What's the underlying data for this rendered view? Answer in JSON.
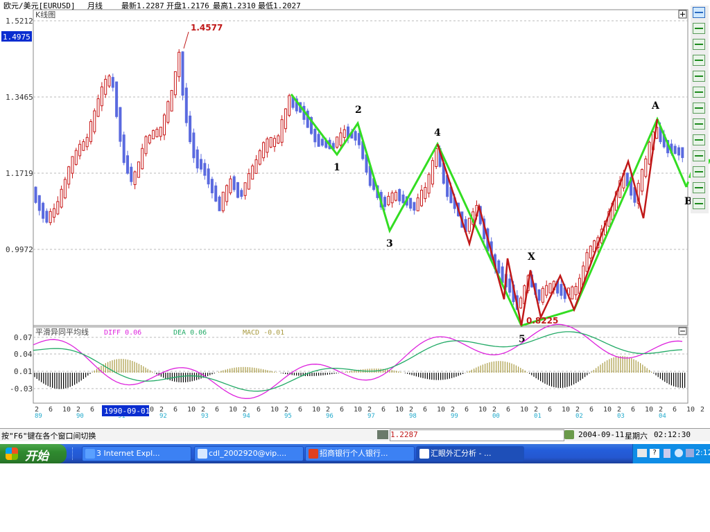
{
  "header": {
    "instrument": "欧元/美元[EURUSD]",
    "period": "月线",
    "latest": "最新1.2287",
    "open": "开盘1.2176",
    "high": "最高1.2310",
    "low": "最低1.2027"
  },
  "kline": {
    "panel_title": "K线图",
    "price_ticks": [
      "1.5212",
      "1.3465",
      "1.1719",
      "0.9972"
    ],
    "cursor_price": "1.4975",
    "high_label": "1.4577",
    "low_label": "0.8225",
    "wave_labels": [
      "1",
      "2",
      "3",
      "4",
      "5",
      "X",
      "A",
      "B",
      "C"
    ]
  },
  "macd": {
    "panel_title": "平滑异同平均线",
    "diff": "DIFF 0.06",
    "dea": "DEA 0.06",
    "macd": "MACD -0.01",
    "ticks": [
      "0.07",
      "0.04",
      "0.01",
      "-0.03"
    ]
  },
  "x_axis": {
    "months": [
      "2",
      "6",
      "10",
      "2",
      "6",
      "10",
      "2",
      "6",
      "10",
      "2",
      "6",
      "10",
      "2",
      "6",
      "10",
      "2",
      "6",
      "10",
      "2",
      "6",
      "10",
      "2",
      "6",
      "10",
      "2",
      "6",
      "10",
      "2",
      "6",
      "10",
      "2",
      "6",
      "10",
      "2",
      "6",
      "10",
      "2",
      "6",
      "10",
      "2",
      "6",
      "10",
      "2",
      "6",
      "10",
      "2",
      "6",
      "10",
      "2"
    ],
    "years": [
      "89",
      "90",
      "91",
      "92",
      "93",
      "94",
      "95",
      "96",
      "97",
      "98",
      "99",
      "00",
      "01",
      "02",
      "03",
      "04"
    ],
    "cursor_date": "1990-09-01"
  },
  "status": {
    "hint": "按\"F6\"键在各个窗口间切换",
    "price": "1.2287",
    "date": "2004-09-11",
    "weekday": "星期六",
    "time": "02:12:30"
  },
  "taskbar": {
    "start_label": "开始",
    "tasks": [
      "3 Internet Expl...",
      "cdl_2002920@vip....",
      "招商银行个人银行...",
      "汇眼外汇分析 - ..."
    ],
    "clock": "2:12"
  },
  "colors": {
    "bear": "#5a6adf",
    "bull": "#c81818",
    "wave_green": "#33dd22",
    "wave_red": "#c01818",
    "diff_line": "#dd22dd",
    "dea_line": "#22aa66",
    "hist_pos": "#a89a40",
    "hist_neg": "#000000"
  }
}
